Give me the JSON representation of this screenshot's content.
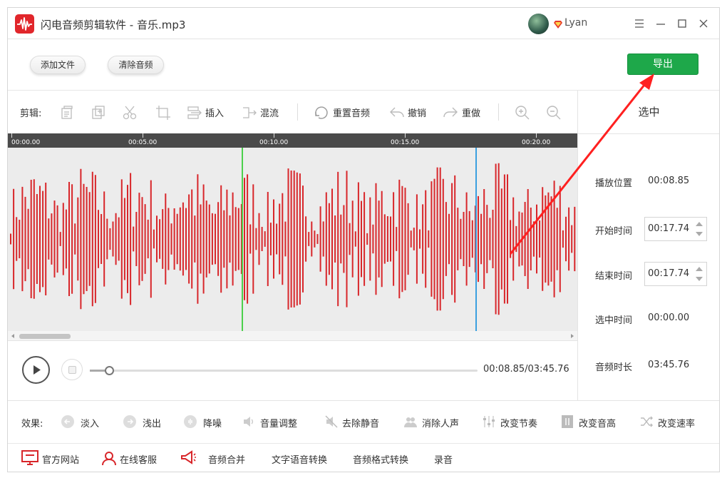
{
  "app": {
    "title": "闪电音频剪辑软件 - 音乐.mp3",
    "username": "Lyan",
    "icons": {
      "logo": "waveform-logo-icon",
      "vip": "diamond-icon",
      "menu": "hamburger-menu-icon",
      "minimize": "minimize-icon",
      "maximize": "maximize-icon",
      "close": "close-icon"
    }
  },
  "actions": {
    "add_file": "添加文件",
    "clear_audio": "清除音频",
    "export": "导出"
  },
  "edit_toolbar": {
    "label": "剪辑:",
    "tools": [
      {
        "icon": "copy-icon",
        "label": ""
      },
      {
        "icon": "paste-icon",
        "label": ""
      },
      {
        "icon": "scissors-icon",
        "label": ""
      },
      {
        "icon": "crop-icon",
        "label": ""
      },
      {
        "icon": "insert-icon",
        "label": "插入"
      },
      {
        "icon": "mix-icon",
        "label": "混流"
      },
      {
        "icon": "reset-audio-icon",
        "label": "重置音频"
      },
      {
        "icon": "undo-icon",
        "label": "撤销"
      },
      {
        "icon": "redo-icon",
        "label": "重做"
      },
      {
        "icon": "zoom-in-icon",
        "label": ""
      },
      {
        "icon": "zoom-out-icon",
        "label": ""
      }
    ]
  },
  "timeline": {
    "ticks": [
      "00:00.00",
      "00:05.00",
      "00:10.00",
      "00:15.00",
      "00:20.00"
    ]
  },
  "selection_panel": {
    "title": "选中",
    "play_position_label": "播放位置",
    "play_position": "00:08.85",
    "start_time_label": "开始时间",
    "start_time": "00:17.74",
    "end_time_label": "结束时间",
    "end_time": "00:17.74",
    "selected_time_label": "选中时间",
    "selected_time": "00:00.00",
    "duration_label": "音频时长",
    "duration": "03:45.76"
  },
  "playback": {
    "time_display": "00:08.85/03:45.76",
    "progress_fraction": 0.05
  },
  "effects": {
    "label": "效果:",
    "items": [
      {
        "icon": "fade-in-icon",
        "label": "淡入"
      },
      {
        "icon": "fade-out-icon",
        "label": "浅出"
      },
      {
        "icon": "denoise-icon",
        "label": "降噪"
      },
      {
        "icon": "volume-icon",
        "label": "音量调整"
      },
      {
        "icon": "mute-icon",
        "label": "去除静音"
      },
      {
        "icon": "remove-vocal-icon",
        "label": "消除人声"
      },
      {
        "icon": "tempo-icon",
        "label": "改变节奏"
      },
      {
        "icon": "pitch-icon",
        "label": "改变音高"
      },
      {
        "icon": "speed-icon",
        "label": "改变速率"
      }
    ]
  },
  "bottom_links": [
    {
      "icon": "monitor-icon",
      "label": "官方网站"
    },
    {
      "icon": "support-icon",
      "label": "在线客服"
    },
    {
      "icon": "megaphone-icon",
      "label": "音频合并"
    },
    {
      "icon": "",
      "label": "文字语音转换"
    },
    {
      "icon": "",
      "label": "音频格式转换"
    },
    {
      "icon": "",
      "label": "录音"
    }
  ],
  "colors": {
    "waveform": "#d8262a",
    "play_cursor": "#4cd04c",
    "selection_cursor": "#3aa0e0",
    "export_button": "#1ea84a",
    "annotation_arrow": "#ff2020",
    "timeline_bar": "#4a4a4a"
  }
}
